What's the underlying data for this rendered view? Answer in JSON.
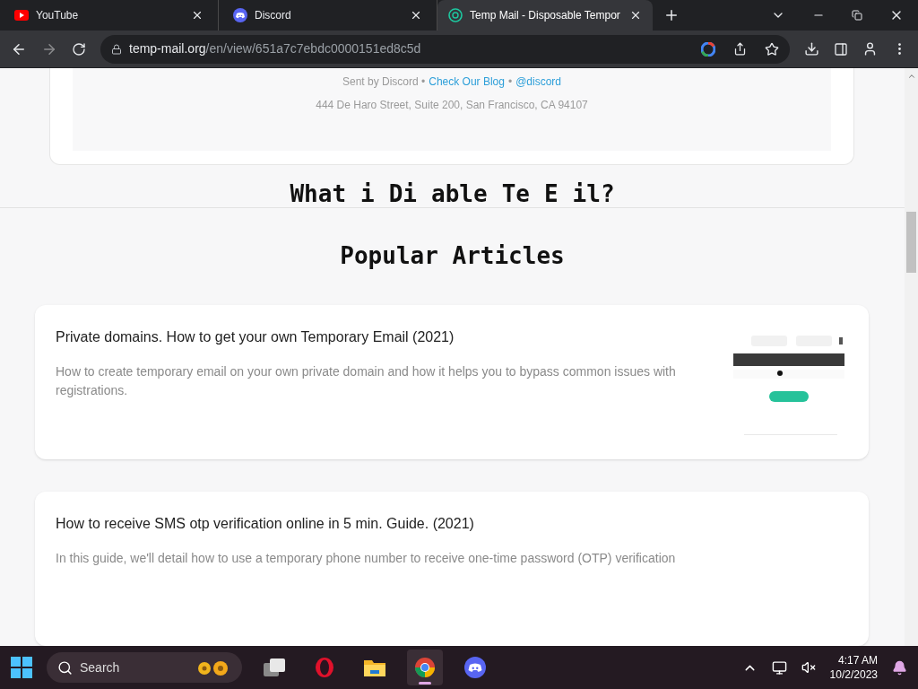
{
  "tabs": [
    {
      "title": "YouTube",
      "kind": "youtube",
      "selected": false
    },
    {
      "title": "Discord",
      "kind": "discord",
      "selected": false
    },
    {
      "title": "Temp Mail - Disposable Tempor",
      "kind": "tempmail",
      "selected": true
    }
  ],
  "address": {
    "host": "temp-mail.org",
    "path": "/en/view/651a7c7ebdc0000151ed8c5d"
  },
  "email_footer": {
    "sent_by": "Sent by Discord •",
    "blog_link": "Check Our Blog",
    "separator": "•",
    "handle_link": "@discord",
    "address": "444 De Haro Street, Suite 200, San Francisco, CA 94107"
  },
  "section_heading_fragments": [
    "What",
    "i",
    "Di",
    "able",
    "Te",
    "E",
    "il?"
  ],
  "popular_heading": "Popular Articles",
  "articles": [
    {
      "title": "Private domains. How to get your own Temporary Email (2021)",
      "description": "How to create temporary email on your own private domain and how it helps you to bypass common issues with registrations.",
      "thumbnail": true
    },
    {
      "title": "How to receive SMS otp verification online in 5 min. Guide. (2021)",
      "description": "In this guide, we'll detail how to use a temporary phone number to receive one-time password (OTP) verification",
      "thumbnail": false
    }
  ],
  "taskbar": {
    "search_placeholder": "Search",
    "apps": [
      {
        "kind": "taskview",
        "selected": false
      },
      {
        "kind": "opera",
        "selected": false
      },
      {
        "kind": "explorer",
        "selected": false
      },
      {
        "kind": "chrome",
        "selected": true
      },
      {
        "kind": "discord",
        "selected": false
      }
    ],
    "time": "4:17 AM",
    "date": "10/2/2023"
  }
}
